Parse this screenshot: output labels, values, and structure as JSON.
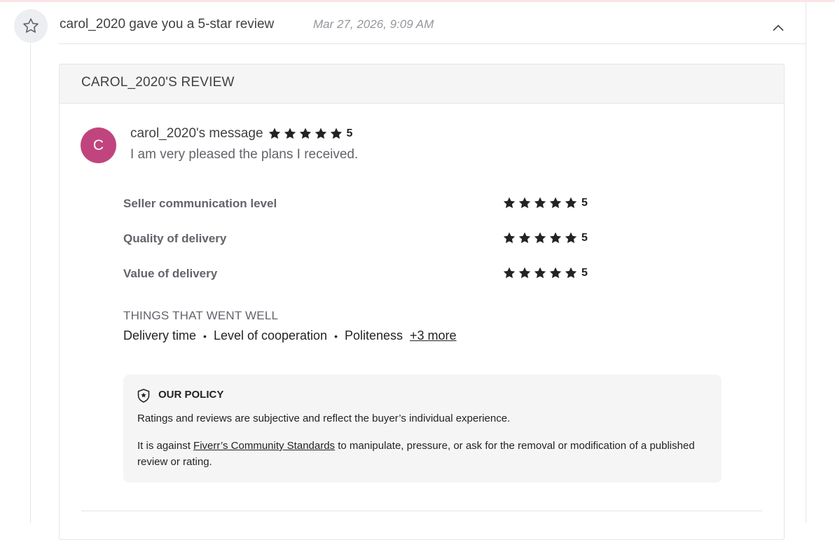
{
  "notification": {
    "title": "carol_2020 gave you a 5-star review",
    "timestamp": "Mar 27, 2026, 9:09 AM",
    "icon": "star-outline-icon"
  },
  "review": {
    "header": "CAROL_2020'S REVIEW",
    "avatar_letter": "C",
    "avatar_color": "#c0457e",
    "message_title": "carol_2020's message",
    "overall_rating": 5,
    "overall_rating_text": "5",
    "message_text": "I am very pleased the plans I received.",
    "ratings": [
      {
        "label": "Seller communication level",
        "value": 5,
        "value_text": "5"
      },
      {
        "label": "Quality of delivery",
        "value": 5,
        "value_text": "5"
      },
      {
        "label": "Value of delivery",
        "value": 5,
        "value_text": "5"
      }
    ],
    "went_well": {
      "title": "THINGS THAT WENT WELL",
      "items": [
        "Delivery time",
        "Level of cooperation",
        "Politeness"
      ],
      "more_label": "+3 more"
    }
  },
  "policy": {
    "title": "OUR POLICY",
    "paragraph1": "Ratings and reviews are subjective and reflect the buyer’s individual experience.",
    "paragraph2_before": "It is against ",
    "paragraph2_link": "Fiverr’s Community Standards",
    "paragraph2_after": " to manipulate, pressure, or ask for the removal or modification of a published review or rating."
  },
  "colors": {
    "star_fill": "#222325",
    "panel_bg": "#f5f5f5",
    "notification_icon_bg": "#eceef2"
  }
}
